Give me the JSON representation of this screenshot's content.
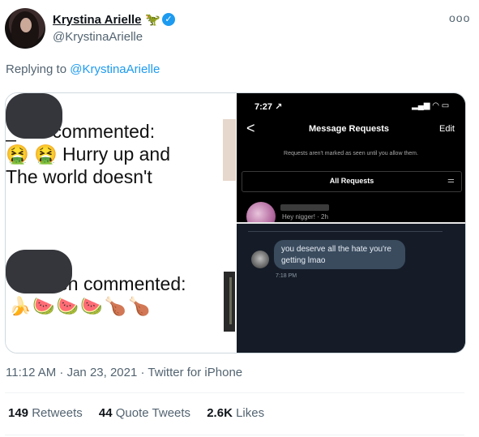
{
  "tweet": {
    "display_name": "Krystina Arielle",
    "name_emoji": "🦖",
    "handle": "@KrystinaArielle",
    "replying_prefix": "Replying to ",
    "replying_to": "@KrystinaArielle",
    "timestamp": "11:12 AM · Jan 23, 2021",
    "source": "Twitter for iPhone",
    "meta_separator": " · "
  },
  "stats": [
    {
      "count": "149",
      "label": "Retweets"
    },
    {
      "count": "44",
      "label": "Quote Tweets"
    },
    {
      "count": "2.6K",
      "label": "Likes"
    }
  ],
  "image_left": {
    "comment1_line1": "_een commented:",
    "comment1_line2_emoji": "🤮 🤮",
    "comment1_line2_text": " Hurry up and",
    "comment1_line3": "The world doesn't",
    "comment2_line1": "en commented:",
    "comment2_emojis": "🍌🍉🍉🍉🍗🍗"
  },
  "image_right": {
    "time": "7:27 ↗",
    "status_icons": "▂▄▆ ◠ ▭",
    "back": "<",
    "title": "Message Requests",
    "edit": "Edit",
    "note": "Requests aren't marked as seen until you allow them.",
    "all_requests": "All Requests",
    "filter_icon": "⚌",
    "request_preview": "Hey nigger! · 2h",
    "dm_message": "you deserve all the hate you're getting lmao",
    "dm_time": "7:18 PM"
  },
  "colors": {
    "accent": "#1d9bf0",
    "muted": "#536471"
  }
}
